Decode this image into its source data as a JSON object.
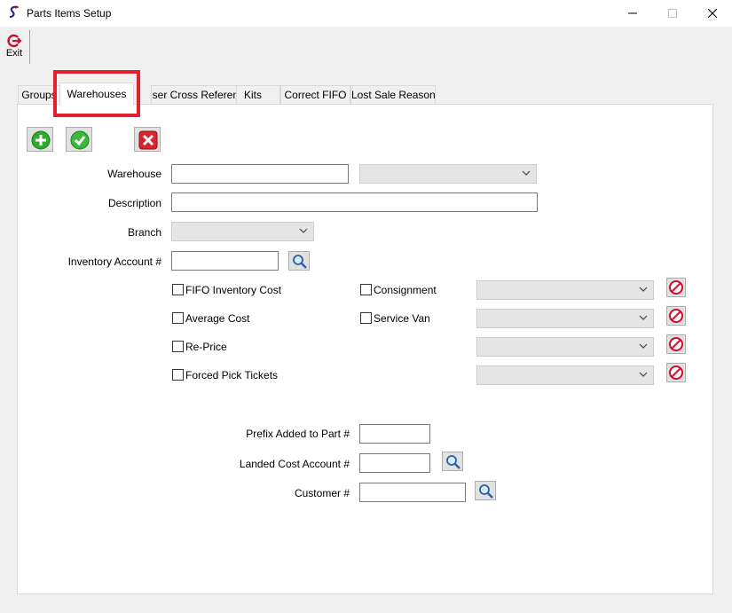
{
  "window": {
    "title": "Parts Items Setup"
  },
  "toolbar": {
    "exit_label": "Exit"
  },
  "tabs": [
    {
      "label": "Groups"
    },
    {
      "label": "Warehouses"
    },
    {
      "label": "User Cross Reference"
    },
    {
      "label": "Kits"
    },
    {
      "label": "Correct FIFO"
    },
    {
      "label": "Lost Sale Reason"
    }
  ],
  "form": {
    "warehouse_label": "Warehouse",
    "warehouse_value": "",
    "warehouse_combo_value": "",
    "description_label": "Description",
    "description_value": "",
    "branch_label": "Branch",
    "branch_value": "",
    "inventory_account_label": "Inventory Account #",
    "inventory_account_value": "",
    "checkboxes": {
      "fifo": "FIFO Inventory Cost",
      "average": "Average Cost",
      "reprice": "Re-Price",
      "forced_pick": "Forced Pick Tickets",
      "consignment": "Consignment",
      "service_van": "Service Van"
    },
    "prefix_label": "Prefix Added to Part #",
    "prefix_value": "",
    "landed_cost_label": "Landed Cost Account #",
    "landed_cost_value": "",
    "customer_label": "Customer #",
    "customer_value": ""
  },
  "colors": {
    "highlight": "#e3202f",
    "add_green": "#2eaa2e",
    "check_green": "#3cb83c",
    "cancel_red": "#d9232e"
  }
}
